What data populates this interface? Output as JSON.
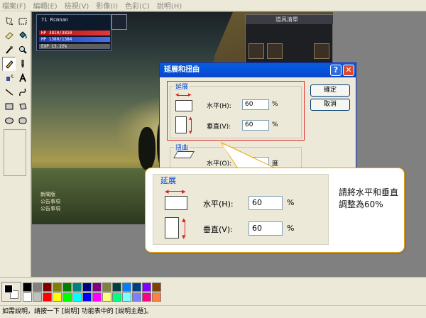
{
  "menu": [
    "檔案(F)",
    "編輯(E)",
    "檢視(V)",
    "影像(I)",
    "色彩(C)",
    "說明(H)"
  ],
  "game": {
    "level_name": "71  Rcmnan",
    "hp_text": "HP   3810/3810",
    "mp_text": "MP   1380/1384",
    "exp_text": "EXP 13.22%",
    "inventory_title": "道具清單",
    "chat_lines": [
      "新聞版",
      "公告事項",
      "公告事項"
    ]
  },
  "dialog": {
    "title": "延展和扭曲",
    "help_glyph": "?",
    "close_glyph": "✕",
    "stretch_label": "延展",
    "horizontal_label": "水平(H):",
    "horizontal_value": "60",
    "vertical_label": "垂直(V):",
    "vertical_value": "60",
    "percent": "%",
    "skew_label": "扭曲",
    "skew_horizontal_label": "水平(O):",
    "skew_unit": "度",
    "ok": "確定",
    "cancel": "取消"
  },
  "callout": {
    "group_label": "延展",
    "horizontal_label": "水平(H):",
    "horizontal_value": "60",
    "vertical_label": "垂直(V):",
    "vertical_value": "60",
    "percent": "%",
    "note": "請將水平和垂直調整為60%"
  },
  "palette": {
    "colors": [
      "#000000",
      "#808080",
      "#800000",
      "#808000",
      "#008000",
      "#008080",
      "#000080",
      "#800080",
      "#808040",
      "#004040",
      "#0080ff",
      "#004080",
      "#8000ff",
      "#804000",
      "#ffffff",
      "#c0c0c0",
      "#ff0000",
      "#ffff00",
      "#00ff00",
      "#00ffff",
      "#0000ff",
      "#ff00ff",
      "#ffff80",
      "#00ff80",
      "#80ffff",
      "#8080ff",
      "#ff0080",
      "#ff8040"
    ]
  },
  "status": {
    "text": "如需說明，請按一下 [說明] 功能表中的 [說明主題]。"
  }
}
